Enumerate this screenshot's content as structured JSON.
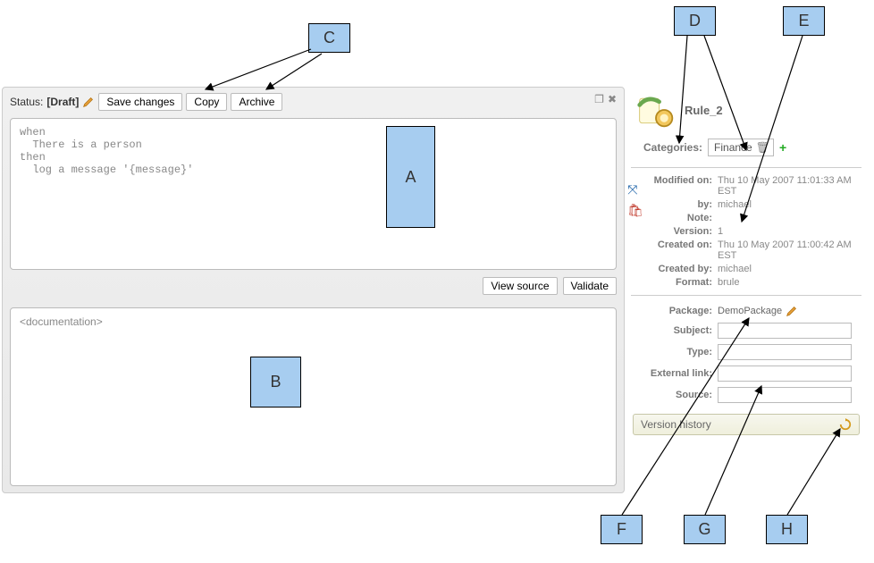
{
  "annotations": {
    "A": "A",
    "B": "B",
    "C": "C",
    "D": "D",
    "E": "E",
    "F": "F",
    "G": "G",
    "H": "H"
  },
  "main": {
    "status_label": "Status:",
    "status_value": "[Draft]",
    "save_btn": "Save changes",
    "copy_btn": "Copy",
    "archive_btn": "Archive",
    "rule_text": "when\n  There is a person\nthen\n  log a message '{message}'",
    "view_source_btn": "View source",
    "validate_btn": "Validate",
    "doc_placeholder": "<documentation>"
  },
  "right": {
    "title": "Rule_2",
    "categories_label": "Categories:",
    "category_chip": "Finance",
    "meta": {
      "modified_on_k": "Modified on:",
      "modified_on_v": "Thu 10 May 2007 11:01:33 AM EST",
      "by_k": "by:",
      "by_v": "michael",
      "note_k": "Note:",
      "note_v": "",
      "version_k": "Version:",
      "version_v": "1",
      "created_on_k": "Created on:",
      "created_on_v": "Thu 10 May 2007 11:00:42 AM EST",
      "created_by_k": "Created by:",
      "created_by_v": "michael",
      "format_k": "Format:",
      "format_v": "brule"
    },
    "form": {
      "package_k": "Package:",
      "package_v": "DemoPackage",
      "subject_k": "Subject:",
      "subject_v": "",
      "type_k": "Type:",
      "type_v": "",
      "extlink_k": "External link:",
      "extlink_v": "",
      "source_k": "Source:",
      "source_v": ""
    },
    "version_history_label": "Version history"
  }
}
